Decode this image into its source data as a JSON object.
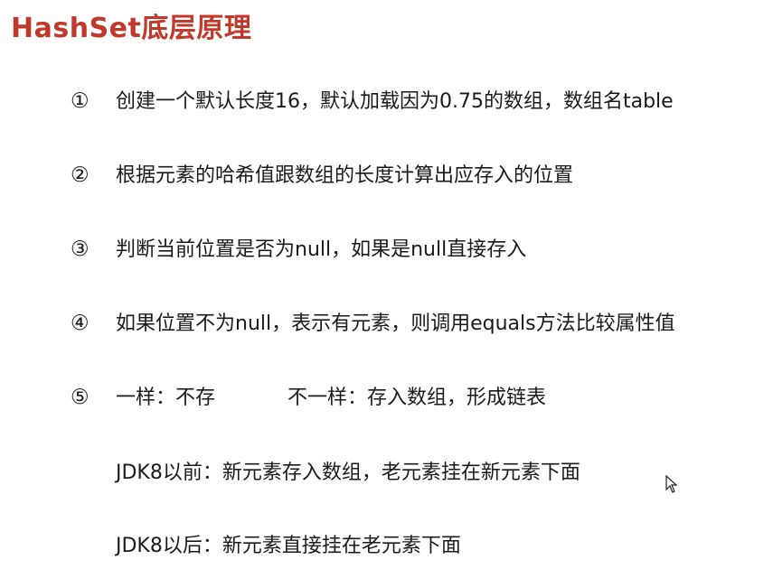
{
  "title": "HashSet底层原理",
  "items": [
    {
      "num": "①",
      "text": "创建一个默认长度16，默认加载因为0.75的数组，数组名table"
    },
    {
      "num": "②",
      "text": "根据元素的哈希值跟数组的长度计算出应存入的位置"
    },
    {
      "num": "③",
      "text": "判断当前位置是否为null，如果是null直接存入"
    },
    {
      "num": "④",
      "text": "如果位置不为null，表示有元素，则调用equals方法比较属性值"
    },
    {
      "num": "⑤",
      "text": "一样：不存",
      "text2": "不一样：存入数组，形成链表"
    }
  ],
  "sub_items": [
    {
      "text": "JDK8以前：新元素存入数组，老元素挂在新元素下面"
    },
    {
      "text": "JDK8以后：新元素直接挂在老元素下面"
    }
  ],
  "icons": {
    "cursor": "mouse-pointer-icon"
  }
}
